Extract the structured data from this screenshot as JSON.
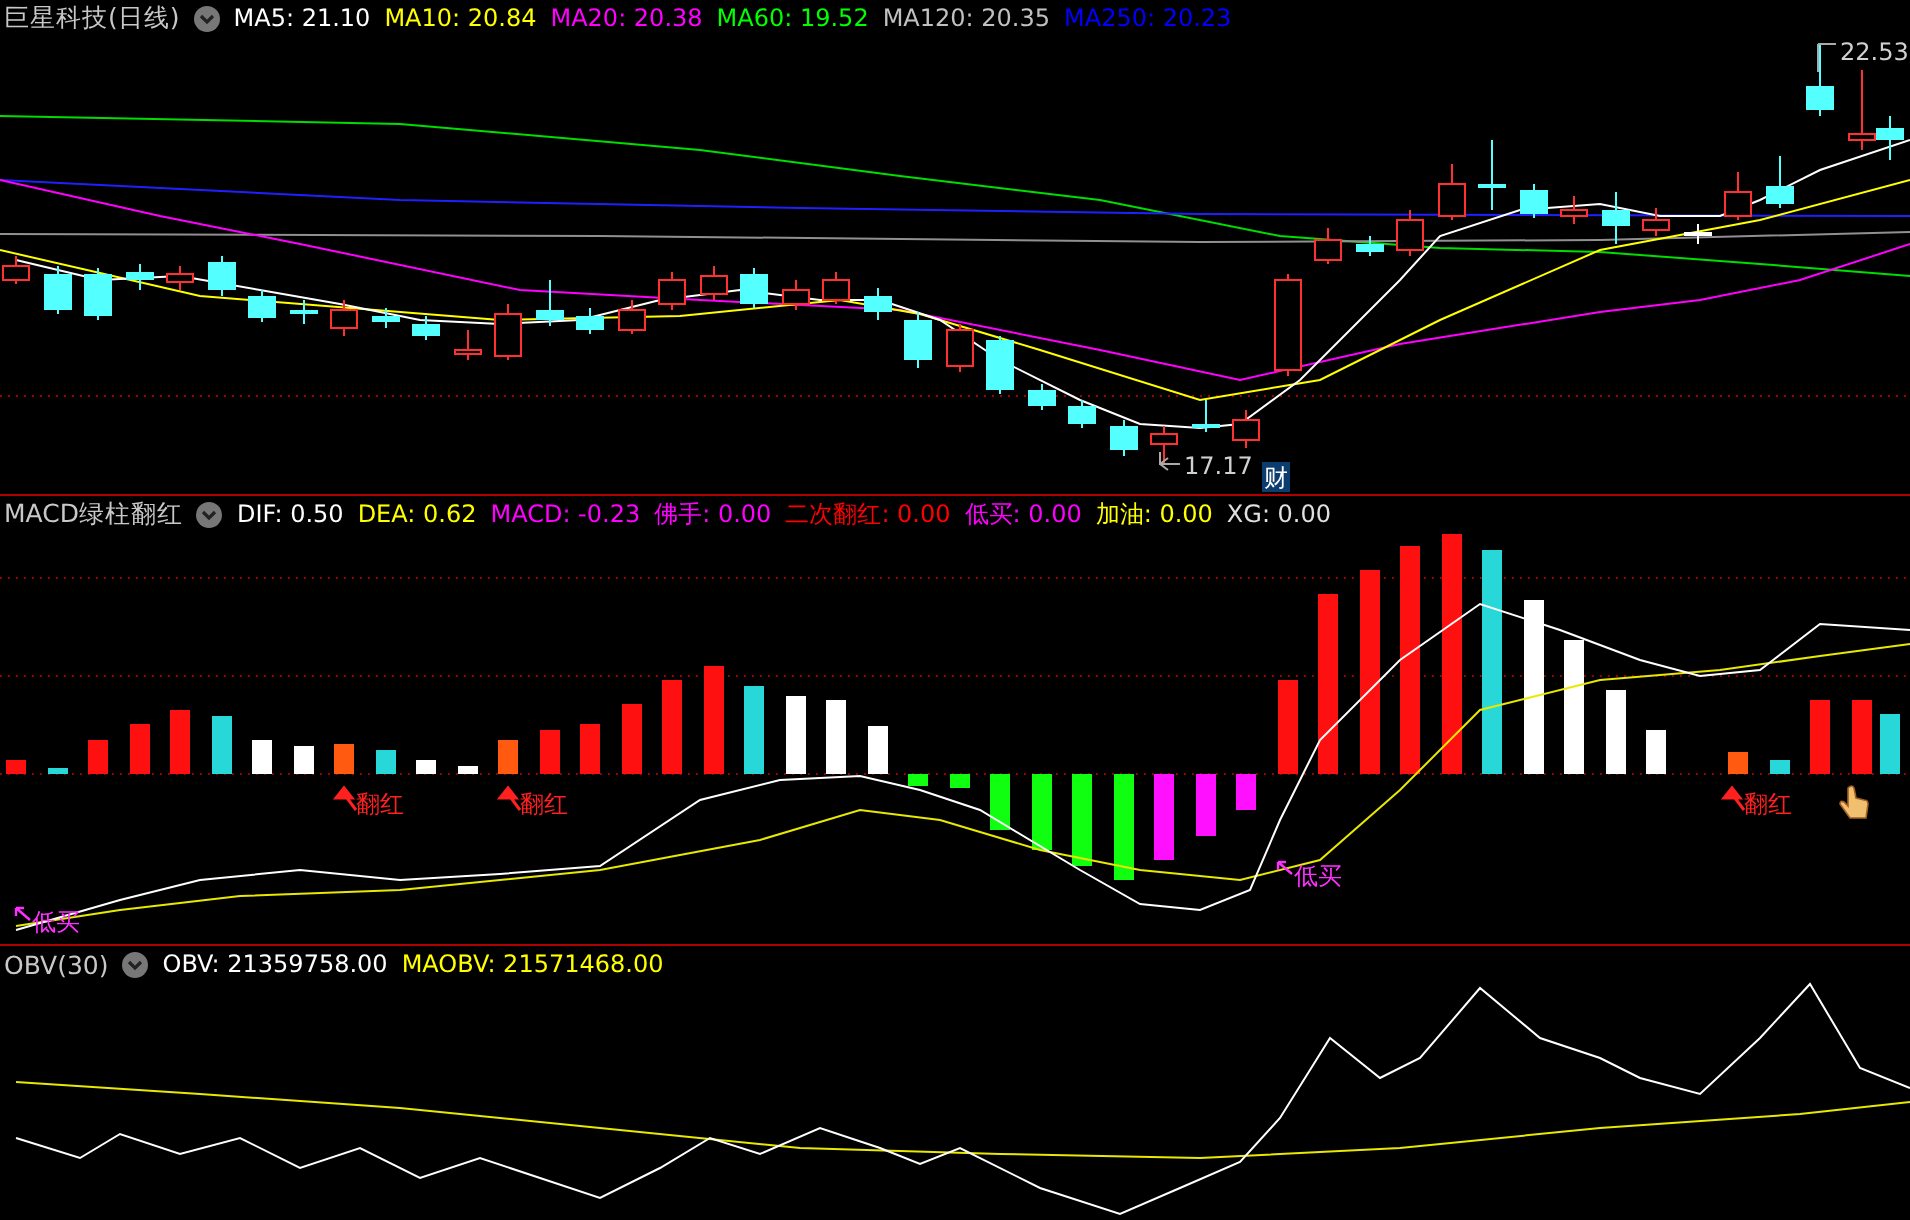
{
  "main": {
    "title": "巨星科技(日线)",
    "indicators": [
      {
        "label": "MA5: 21.10",
        "color": "#ffffff"
      },
      {
        "label": "MA10: 20.84",
        "color": "#ffff00"
      },
      {
        "label": "MA20: 20.38",
        "color": "#ff00ff"
      },
      {
        "label": "MA60: 19.52",
        "color": "#00ff00"
      },
      {
        "label": "MA120: 20.35",
        "color": "#c0c0c0"
      },
      {
        "label": "MA250: 20.23",
        "color": "#0000ff"
      }
    ],
    "price_labels": [
      {
        "kind": "high",
        "text": "22.53"
      },
      {
        "kind": "low",
        "text": "17.17"
      }
    ],
    "badge": "财"
  },
  "macd": {
    "title": "MACD绿柱翻红",
    "indicators": [
      {
        "label": "DIF: 0.50",
        "color": "#ffffff"
      },
      {
        "label": "DEA: 0.62",
        "color": "#ffff00"
      },
      {
        "label": "MACD: -0.23",
        "color": "#ff00ff"
      },
      {
        "label": "佛手: 0.00",
        "color": "#ff00ff"
      },
      {
        "label": "二次翻红: 0.00",
        "color": "#ff0000"
      },
      {
        "label": "低买: 0.00",
        "color": "#ff00ff"
      },
      {
        "label": "加油: 0.00",
        "color": "#ffff00"
      },
      {
        "label": "XG: 0.00",
        "color": "#e0e0e0"
      }
    ],
    "signals": [
      {
        "kind": "flip-red",
        "text": "翻红"
      },
      {
        "kind": "flip-red",
        "text": "翻红"
      },
      {
        "kind": "flip-red",
        "text": "翻红"
      },
      {
        "kind": "low-buy",
        "text": "低买"
      },
      {
        "kind": "low-buy",
        "text": "低买"
      }
    ]
  },
  "obv": {
    "title": "OBV(30)",
    "indicators": [
      {
        "label": "OBV: 21359758.00",
        "color": "#ffffff"
      },
      {
        "label": "MAOBV: 21571468.00",
        "color": "#ffff00"
      }
    ]
  }
}
